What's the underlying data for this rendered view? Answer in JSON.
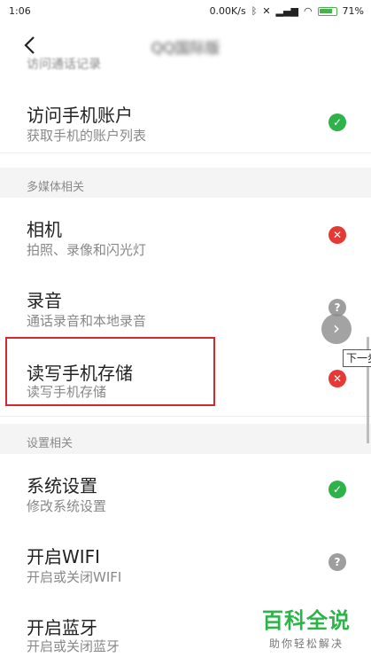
{
  "status_bar": {
    "time": "1:06",
    "speed": "0.00K/s",
    "battery": "71%"
  },
  "header": {
    "title": "QQ国际版"
  },
  "partial_item": "访问通话记录",
  "items": [
    {
      "title": "访问手机账户",
      "subtitle": "获取手机的账户列表",
      "status": "allowed",
      "symbol": "✓"
    },
    {
      "title": "相机",
      "subtitle": "拍照、录像和闪光灯",
      "status": "denied",
      "symbol": "✕"
    },
    {
      "title": "录音",
      "subtitle": "通话录音和本地录音",
      "status": "ask",
      "symbol": "?"
    },
    {
      "title": "读写手机存储",
      "subtitle": "读写手机存储",
      "status": "denied",
      "symbol": "✕"
    },
    {
      "title": "系统设置",
      "subtitle": "修改系统设置",
      "status": "allowed",
      "symbol": "✓"
    },
    {
      "title": "开启WIFI",
      "subtitle": "开启或关闭WIFI",
      "status": "ask",
      "symbol": "?"
    },
    {
      "title": "开启蓝牙",
      "subtitle": "开启或关闭蓝牙",
      "status": "none",
      "symbol": ""
    }
  ],
  "sections": {
    "multimedia": "多媒体相关",
    "settings": "设置相关"
  },
  "tooltip": "下一步",
  "next_button": "›",
  "watermark": {
    "main": "百科全说",
    "sub": "助你轻松解决"
  },
  "colors": {
    "allowed": "#2eb24a",
    "denied": "#e53935",
    "ask": "#9e9e9e",
    "highlight": "#d9262c"
  }
}
